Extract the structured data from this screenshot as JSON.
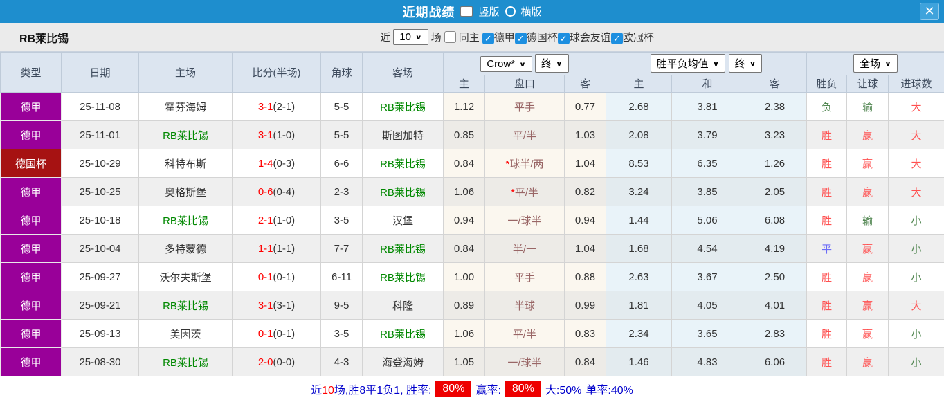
{
  "topbar": {
    "title": "近期战绩",
    "radio_vertical": "竖版",
    "radio_horizontal": "横版",
    "close_label": "×"
  },
  "filter": {
    "team": "RB莱比锡",
    "near_label": "近",
    "count_value": "10",
    "matches_label": "场",
    "same_home_label": "同主",
    "leagues": [
      "德甲",
      "德国杯",
      "球会友谊",
      "欧冠杯"
    ]
  },
  "colors": {
    "topbar_blue": "#1e8ece",
    "type_league": "#990099",
    "type_cup": "#a61212",
    "team_green": "#008800",
    "score_red": "#ff0000",
    "win_red": "#ff5050",
    "lose_green": "#548854",
    "draw_blue": "#6b6bf7",
    "badge_red": "#ee0000",
    "footer_blue": "#0000cc"
  },
  "table": {
    "main_headers": [
      "类型",
      "日期",
      "主场",
      "比分(半场)",
      "角球",
      "客场"
    ],
    "selects": {
      "odds_company": "Crow*",
      "odds_final": "终",
      "avg_label": "胜平负均值",
      "avg_final": "终",
      "full_match": "全场"
    },
    "sub_headers": [
      "主",
      "盘口",
      "客",
      "主",
      "和",
      "客",
      "胜负",
      "让球",
      "进球数"
    ],
    "rows": [
      {
        "type": "德甲",
        "type_key": "league",
        "date": "25-11-08",
        "home": "霍芬海姆",
        "home_rb": false,
        "score": "3-1",
        "half": "(2-1)",
        "corners": "5-5",
        "away": "RB莱比锡",
        "away_rb": true,
        "home_odds": "1.12",
        "handicap": "平手",
        "handicap_star": false,
        "away_odds": "0.77",
        "avg_home": "2.68",
        "avg_draw": "3.81",
        "avg_away": "2.38",
        "result": "负",
        "result_color": "green",
        "let_result": "输",
        "let_color": "green",
        "goals": "大",
        "goals_color": "red"
      },
      {
        "type": "德甲",
        "type_key": "league",
        "date": "25-11-01",
        "home": "RB莱比锡",
        "home_rb": true,
        "score": "3-1",
        "half": "(1-0)",
        "corners": "5-5",
        "away": "斯图加特",
        "away_rb": false,
        "home_odds": "0.85",
        "handicap": "平/半",
        "handicap_star": false,
        "away_odds": "1.03",
        "avg_home": "2.08",
        "avg_draw": "3.79",
        "avg_away": "3.23",
        "result": "胜",
        "result_color": "red",
        "let_result": "赢",
        "let_color": "red",
        "goals": "大",
        "goals_color": "red"
      },
      {
        "type": "德国杯",
        "type_key": "cup",
        "date": "25-10-29",
        "home": "科特布斯",
        "home_rb": false,
        "score": "1-4",
        "half": "(0-3)",
        "corners": "6-6",
        "away": "RB莱比锡",
        "away_rb": true,
        "home_odds": "0.84",
        "handicap": "球半/两",
        "handicap_star": true,
        "away_odds": "1.04",
        "avg_home": "8.53",
        "avg_draw": "6.35",
        "avg_away": "1.26",
        "result": "胜",
        "result_color": "red",
        "let_result": "赢",
        "let_color": "red",
        "goals": "大",
        "goals_color": "red"
      },
      {
        "type": "德甲",
        "type_key": "league",
        "date": "25-10-25",
        "home": "奥格斯堡",
        "home_rb": false,
        "score": "0-6",
        "half": "(0-4)",
        "corners": "2-3",
        "away": "RB莱比锡",
        "away_rb": true,
        "home_odds": "1.06",
        "handicap": "平/半",
        "handicap_star": true,
        "away_odds": "0.82",
        "avg_home": "3.24",
        "avg_draw": "3.85",
        "avg_away": "2.05",
        "result": "胜",
        "result_color": "red",
        "let_result": "赢",
        "let_color": "red",
        "goals": "大",
        "goals_color": "red"
      },
      {
        "type": "德甲",
        "type_key": "league",
        "date": "25-10-18",
        "home": "RB莱比锡",
        "home_rb": true,
        "score": "2-1",
        "half": "(1-0)",
        "corners": "3-5",
        "away": "汉堡",
        "away_rb": false,
        "home_odds": "0.94",
        "handicap": "一/球半",
        "handicap_star": false,
        "away_odds": "0.94",
        "avg_home": "1.44",
        "avg_draw": "5.06",
        "avg_away": "6.08",
        "result": "胜",
        "result_color": "red",
        "let_result": "输",
        "let_color": "green",
        "goals": "小",
        "goals_color": "green"
      },
      {
        "type": "德甲",
        "type_key": "league",
        "date": "25-10-04",
        "home": "多特蒙德",
        "home_rb": false,
        "score": "1-1",
        "half": "(1-1)",
        "corners": "7-7",
        "away": "RB莱比锡",
        "away_rb": true,
        "home_odds": "0.84",
        "handicap": "半/一",
        "handicap_star": false,
        "away_odds": "1.04",
        "avg_home": "1.68",
        "avg_draw": "4.54",
        "avg_away": "4.19",
        "result": "平",
        "result_color": "blue",
        "let_result": "赢",
        "let_color": "red",
        "goals": "小",
        "goals_color": "green"
      },
      {
        "type": "德甲",
        "type_key": "league",
        "date": "25-09-27",
        "home": "沃尔夫斯堡",
        "home_rb": false,
        "score": "0-1",
        "half": "(0-1)",
        "corners": "6-11",
        "away": "RB莱比锡",
        "away_rb": true,
        "home_odds": "1.00",
        "handicap": "平手",
        "handicap_star": false,
        "away_odds": "0.88",
        "avg_home": "2.63",
        "avg_draw": "3.67",
        "avg_away": "2.50",
        "result": "胜",
        "result_color": "red",
        "let_result": "赢",
        "let_color": "red",
        "goals": "小",
        "goals_color": "green"
      },
      {
        "type": "德甲",
        "type_key": "league",
        "date": "25-09-21",
        "home": "RB莱比锡",
        "home_rb": true,
        "score": "3-1",
        "half": "(3-1)",
        "corners": "9-5",
        "away": "科隆",
        "away_rb": false,
        "home_odds": "0.89",
        "handicap": "半球",
        "handicap_star": false,
        "away_odds": "0.99",
        "avg_home": "1.81",
        "avg_draw": "4.05",
        "avg_away": "4.01",
        "result": "胜",
        "result_color": "red",
        "let_result": "赢",
        "let_color": "red",
        "goals": "大",
        "goals_color": "red"
      },
      {
        "type": "德甲",
        "type_key": "league",
        "date": "25-09-13",
        "home": "美因茨",
        "home_rb": false,
        "score": "0-1",
        "half": "(0-1)",
        "corners": "3-5",
        "away": "RB莱比锡",
        "away_rb": true,
        "home_odds": "1.06",
        "handicap": "平/半",
        "handicap_star": false,
        "away_odds": "0.83",
        "avg_home": "2.34",
        "avg_draw": "3.65",
        "avg_away": "2.83",
        "result": "胜",
        "result_color": "red",
        "let_result": "赢",
        "let_color": "red",
        "goals": "小",
        "goals_color": "green"
      },
      {
        "type": "德甲",
        "type_key": "league",
        "date": "25-08-30",
        "home": "RB莱比锡",
        "home_rb": true,
        "score": "2-0",
        "half": "(0-0)",
        "corners": "4-3",
        "away": "海登海姆",
        "away_rb": false,
        "home_odds": "1.05",
        "handicap": "一/球半",
        "handicap_star": false,
        "away_odds": "0.84",
        "avg_home": "1.46",
        "avg_draw": "4.83",
        "avg_away": "6.06",
        "result": "胜",
        "result_color": "red",
        "let_result": "赢",
        "let_color": "red",
        "goals": "小",
        "goals_color": "green"
      }
    ]
  },
  "footer": {
    "near_label": "近",
    "count": "10",
    "summary": "场,胜8平1负1, 胜率:",
    "win_rate_badge": "80%",
    "profit_label": "赢率:",
    "profit_badge": "80%",
    "big_label": "大:",
    "big_value": "50%",
    "single_label": "单率:",
    "single_value": "40%"
  }
}
